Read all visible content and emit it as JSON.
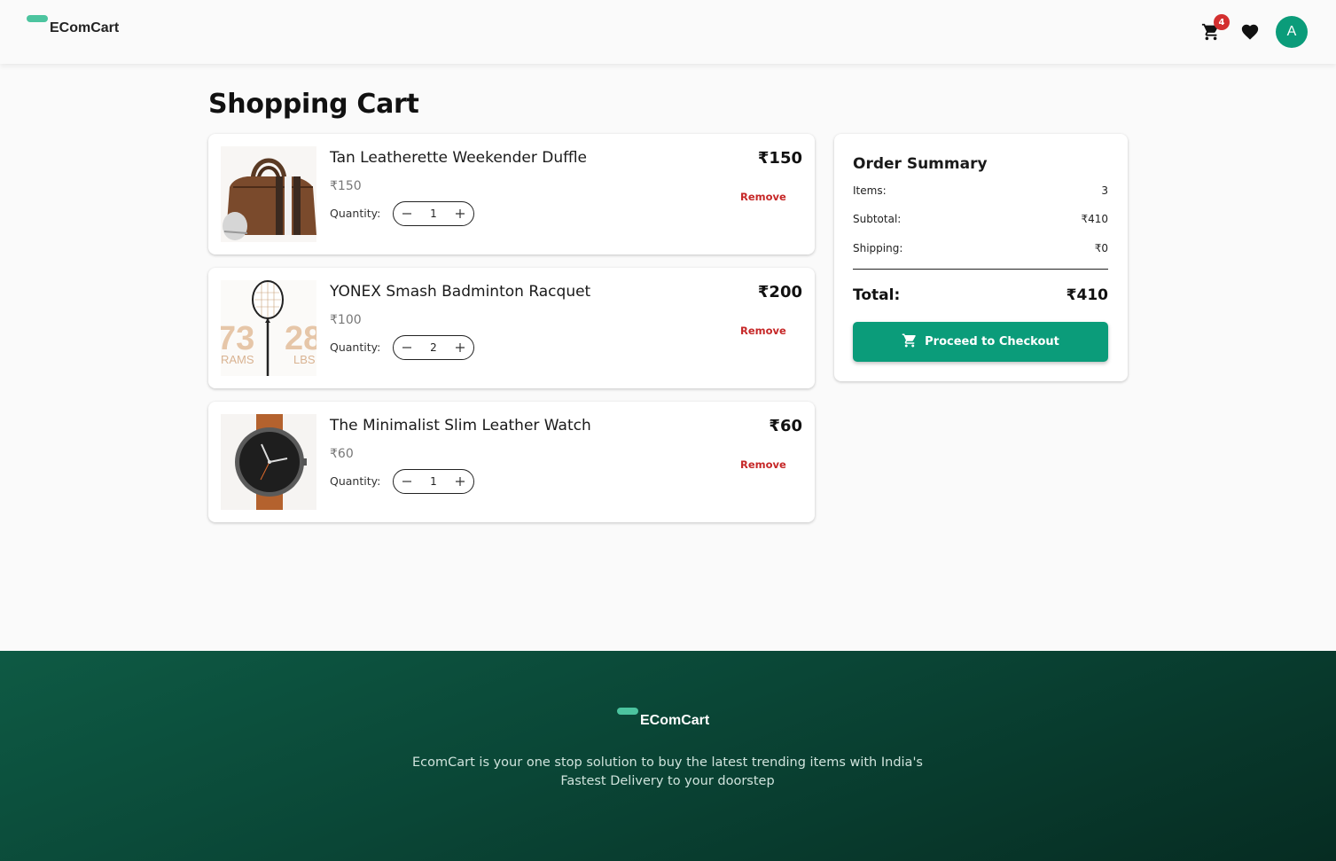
{
  "header": {
    "brand": "EComCart",
    "cart_count": "4",
    "avatar_initial": "A"
  },
  "page": {
    "title": "Shopping Cart"
  },
  "cart": {
    "quantity_label": "Quantity:",
    "remove_label": "Remove",
    "items": [
      {
        "name": "Tan Leatherette Weekender Duffle",
        "unit_price": "₹150",
        "quantity": "1",
        "total": "₹150"
      },
      {
        "name": "YONEX Smash Badminton Racquet",
        "unit_price": "₹100",
        "quantity": "2",
        "total": "₹200"
      },
      {
        "name": "The Minimalist Slim Leather Watch",
        "unit_price": "₹60",
        "quantity": "1",
        "total": "₹60"
      }
    ]
  },
  "summary": {
    "title": "Order Summary",
    "items_label": "Items:",
    "items_value": "3",
    "subtotal_label": "Subtotal:",
    "subtotal_value": "₹410",
    "shipping_label": "Shipping:",
    "shipping_value": "₹0",
    "total_label": "Total:",
    "total_value": "₹410",
    "checkout_label": "Proceed to Checkout"
  },
  "footer": {
    "brand": "EComCart",
    "description": "EcomCart is your one stop solution to buy the latest trending items with India's Fastest Delivery to your doorstep"
  },
  "colors": {
    "accent": "#0b9c7a",
    "logo_pill": "#4cc49f",
    "remove": "#c62828",
    "badge": "#d32f2f"
  }
}
